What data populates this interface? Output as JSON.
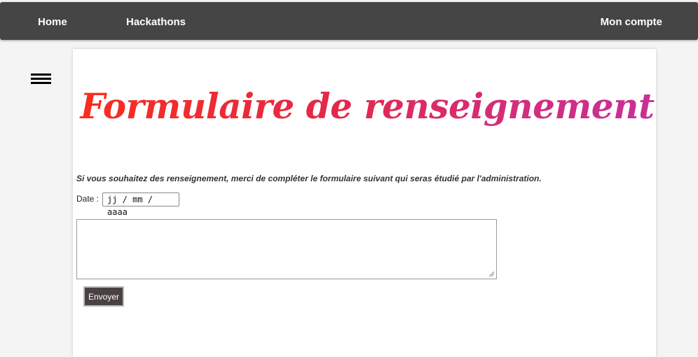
{
  "nav": {
    "home": "Home",
    "hackathons": "Hackathons",
    "account": "Mon compte"
  },
  "menu": {
    "icon": "hamburger-menu-icon"
  },
  "page": {
    "title": "Formulaire de renseignement",
    "intro": "Si vous souhaitez des renseignement, merci de compléter le formulaire suivant qui seras étudié par l'administration."
  },
  "form": {
    "date_label": "Date :",
    "date_placeholder": "jj / mm / aaaa",
    "message_value": "",
    "submit_label": "Envoyer"
  },
  "colors": {
    "navbar": "#454545",
    "title_gradient_start": "#fa2d1c",
    "title_gradient_end": "#c83097",
    "button": "#4a4242"
  }
}
